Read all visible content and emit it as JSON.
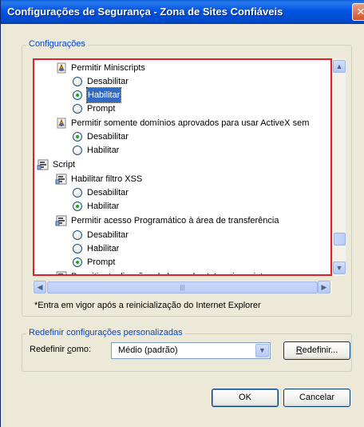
{
  "window": {
    "title": "Configurações de Segurança - Zona de Sites Confiáveis",
    "close_glyph": "✕"
  },
  "settings_group": {
    "legend": "Configurações",
    "items": [
      {
        "kind": "setting",
        "icon": "activex-setting-icon",
        "label": "Permitir Miniscripts"
      },
      {
        "kind": "option",
        "label": "Desabilitar",
        "checked": false,
        "selected": false
      },
      {
        "kind": "option",
        "label": "Habilitar",
        "checked": true,
        "selected": true
      },
      {
        "kind": "option",
        "label": "Prompt",
        "checked": false,
        "selected": false
      },
      {
        "kind": "setting",
        "icon": "activex-setting-icon",
        "label": "Permitir somente domínios aprovados para usar ActiveX sem"
      },
      {
        "kind": "option",
        "label": "Desabilitar",
        "checked": true,
        "selected": false
      },
      {
        "kind": "option",
        "label": "Habilitar",
        "checked": false,
        "selected": false
      },
      {
        "kind": "category",
        "icon": "script-category-icon",
        "label": "Script"
      },
      {
        "kind": "setting",
        "icon": "script-setting-icon",
        "label": "Habilitar filtro XSS"
      },
      {
        "kind": "option",
        "label": "Desabilitar",
        "checked": false,
        "selected": false
      },
      {
        "kind": "option",
        "label": "Habilitar",
        "checked": true,
        "selected": false
      },
      {
        "kind": "setting",
        "icon": "script-setting-icon",
        "label": "Permitir acesso Programático à área de transferência"
      },
      {
        "kind": "option",
        "label": "Desabilitar",
        "checked": false,
        "selected": false
      },
      {
        "kind": "option",
        "label": "Habilitar",
        "checked": false,
        "selected": false
      },
      {
        "kind": "option",
        "label": "Prompt",
        "checked": true,
        "selected": false
      },
      {
        "kind": "setting",
        "icon": "script-setting-icon",
        "label": "Permitir atualizações da barra de status via script"
      }
    ],
    "note": "*Entra em vigor após a reinicialização do Internet Explorer"
  },
  "reset_group": {
    "legend": "Redefinir configurações personalizadas",
    "reset_to_label_prefix": "Redefinir ",
    "reset_to_label_accel": "c",
    "reset_to_label_suffix": "omo:",
    "combo_value": "Médio (padrão)",
    "reset_button_accel": "R",
    "reset_button_rest": "edefinir..."
  },
  "buttons": {
    "ok": "OK",
    "cancel": "Cancelar"
  },
  "scrollbars": {
    "up_glyph": "▲",
    "down_glyph": "▼",
    "left_glyph": "◀",
    "right_glyph": "▶",
    "thumb_grip": "|||",
    "combo_arrow": "▼"
  },
  "colors": {
    "title_blue": "#0054e3",
    "legend_blue": "#0046d5",
    "highlight_frame": "#e0202c",
    "selection": "#316ac5"
  }
}
